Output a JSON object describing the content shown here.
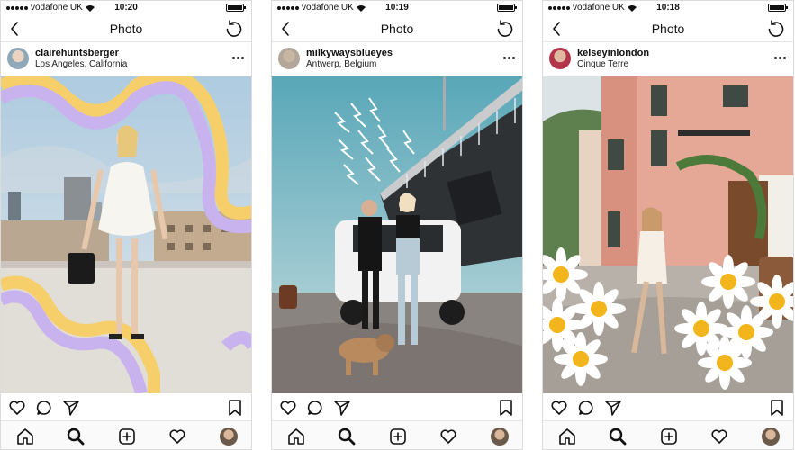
{
  "screens": [
    {
      "carrier": "vodafone UK",
      "time": "10:20",
      "nav_title": "Photo",
      "username": "clairehuntsberger",
      "location": "Los Angeles, California"
    },
    {
      "carrier": "vodafone UK",
      "time": "10:19",
      "nav_title": "Photo",
      "username": "milkywaysblueyes",
      "location": "Antwerp, Belgium"
    },
    {
      "carrier": "vodafone UK",
      "time": "10:18",
      "nav_title": "Photo",
      "username": "kelseyinlondon",
      "location": "Cinque Terre"
    }
  ],
  "icons": {
    "back": "chevron-left-icon",
    "refresh": "refresh-icon",
    "more": "more-horizontal-icon",
    "like": "heart-icon",
    "comment": "comment-icon",
    "share": "send-icon",
    "save": "bookmark-icon",
    "home": "home-icon",
    "search": "search-icon",
    "new_post": "plus-square-icon",
    "activity": "heart-icon",
    "profile": "avatar"
  },
  "colors": {
    "background": "#ffffff",
    "divider": "#e5e5e5",
    "text": "#111111"
  }
}
